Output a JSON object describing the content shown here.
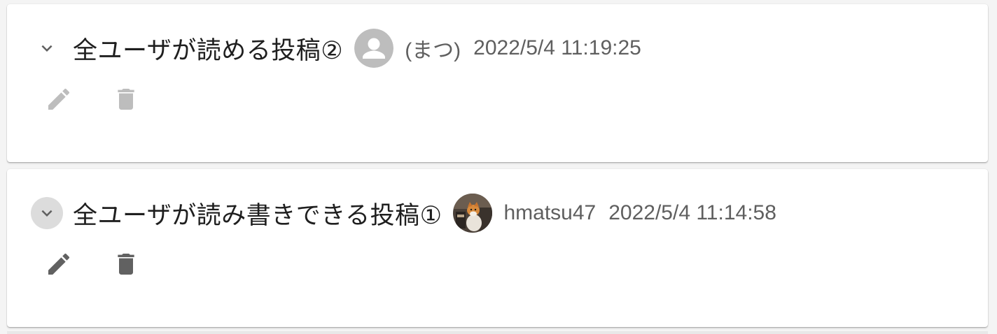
{
  "posts": [
    {
      "title": "全ユーザが読める投稿②",
      "author": "(まつ)",
      "timestamp": "2022/5/4 11:19:25",
      "avatar": "default-person-icon",
      "actions_enabled": false
    },
    {
      "title": "全ユーザが読み書きできる投稿①",
      "author": "hmatsu47",
      "timestamp": "2022/5/4 11:14:58",
      "avatar": "user-photo",
      "actions_enabled": true
    }
  ],
  "colors": {
    "text_primary": "#1f1f1f",
    "text_secondary": "#5f5f5f",
    "icon_disabled": "#bdbdbd",
    "icon_enabled": "#616161",
    "avatar_default_bg": "#bdbdbd"
  }
}
